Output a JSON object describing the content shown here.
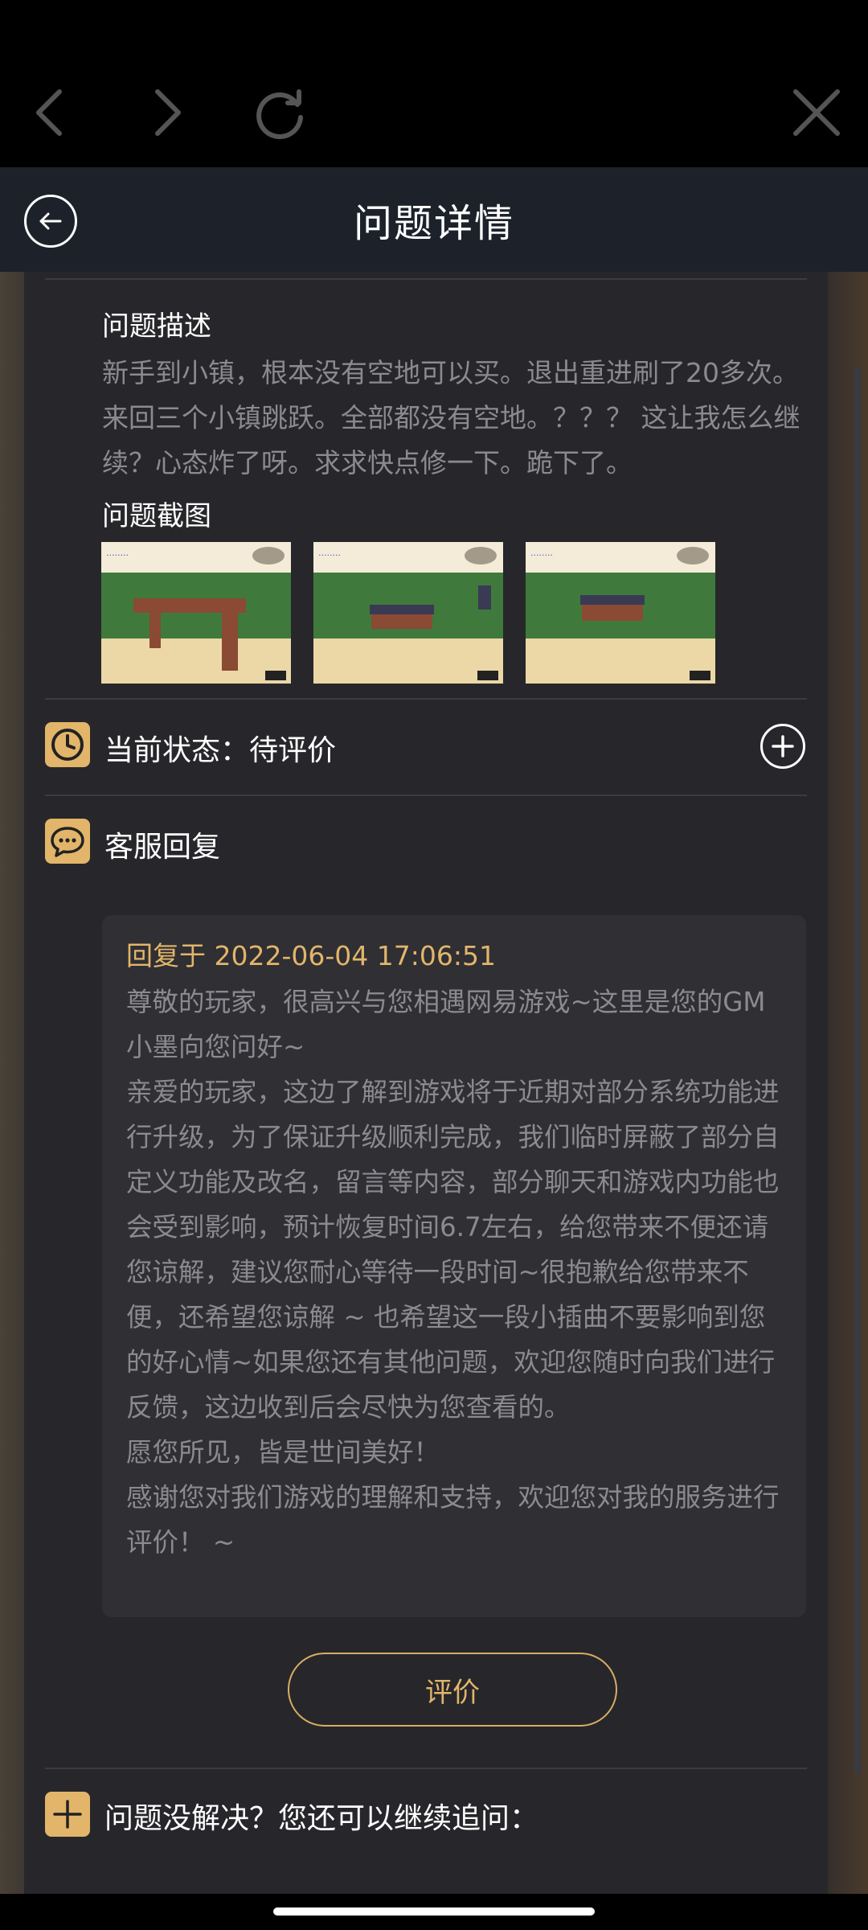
{
  "browser": {
    "icons": [
      "back-chevron-icon",
      "forward-chevron-icon",
      "refresh-icon",
      "close-icon"
    ]
  },
  "header": {
    "title": "问题详情"
  },
  "description": {
    "label": "问题描述",
    "text": "新手到小镇，根本没有空地可以买。退出重进刷了20多次。来回三个小镇跳跃。全部都没有空地。？？？ 这让我怎么继续？心态炸了呀。求求快点修一下。跪下了。"
  },
  "screenshots": {
    "label": "问题截图",
    "count": 3
  },
  "status": {
    "text": "当前状态：待评价"
  },
  "reply": {
    "title": "客服回复",
    "time": "回复于 2022-06-04 17:06:51",
    "paragraphs": [
      "尊敬的玩家，很高兴与您相遇网易游戏~这里是您的GM小墨向您问好~",
      "亲爱的玩家，这边了解到游戏将于近期对部分系统功能进行升级，为了保证升级顺利完成，我们临时屏蔽了部分自定义功能及改名，留言等内容，部分聊天和游戏内功能也会受到影响，预计恢复时间6.7左右，给您带来不便还请您谅解，建议您耐心等待一段时间~很抱歉给您带来不便，还希望您谅解 ~ 也希望这一段小插曲不要影响到您的好心情~如果您还有其他问题，欢迎您随时向我们进行反馈，这边收到后会尽快为您查看的。",
      "愿您所见，皆是世间美好！",
      "感谢您对我们游戏的理解和支持，欢迎您对我的服务进行评价！ ~"
    ]
  },
  "rate_button": {
    "label": "评价"
  },
  "followup": {
    "text": "问题没解决？您还可以继续追问："
  },
  "colors": {
    "accent": "#e2b56a",
    "header_bg": "#1d212a",
    "card_bg": "#27272b"
  }
}
